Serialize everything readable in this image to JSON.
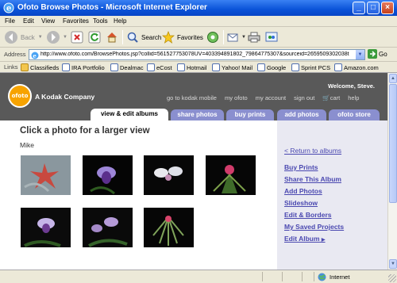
{
  "window": {
    "title": "Ofoto Browse Photos - Microsoft Internet Explorer"
  },
  "menu": [
    "File",
    "Edit",
    "View",
    "Favorites",
    "Tools",
    "Help"
  ],
  "toolbar": {
    "back": "Back",
    "search": "Search",
    "favorites": "Favorites"
  },
  "address": {
    "label": "Address",
    "url": "http://www.ofoto.com/BrowsePhotos.jsp?collid=561527753078UV=403394891802_79864775307&sourceid=2659509302038t",
    "go": "Go"
  },
  "links": {
    "label": "Links",
    "items": [
      "Classifieds",
      "IRA Portfolio",
      "Dealmac",
      "eCost",
      "Hotmail",
      "Yahoo! Mail",
      "Google",
      "Sprint PCS",
      "Amazon.com"
    ]
  },
  "site": {
    "logo_text": "ofoto",
    "company": "A Kodak Company",
    "welcome": "Welcome, Steve.",
    "top_links": [
      "go to kodak mobile",
      "my ofoto",
      "my account",
      "sign out",
      "cart",
      "help"
    ],
    "tabs": [
      "view & edit albums",
      "share photos",
      "buy prints",
      "add photos",
      "ofoto store"
    ],
    "heading": "Click a photo for a larger view",
    "owner": "Mike",
    "photos": [
      "photo-1",
      "photo-2",
      "photo-3",
      "photo-4",
      "photo-5",
      "photo-6",
      "photo-7"
    ],
    "side_links": {
      "return": "< Return to albums",
      "buy_prints": "Buy Prints",
      "share": "Share This Album",
      "add_photos": "Add Photos",
      "slideshow": "Slideshow",
      "edit_borders": "Edit & Borders",
      "saved_projects": "My Saved Projects",
      "edit_album": "Edit Album"
    }
  },
  "status": {
    "zone": "Internet"
  },
  "colors": {
    "titlebar": "#0a53d8",
    "header": "#595959",
    "tab": "#8a8fcf",
    "panel": "#e9e9f2",
    "link": "#4a48b0",
    "logo": "#f7a300"
  }
}
